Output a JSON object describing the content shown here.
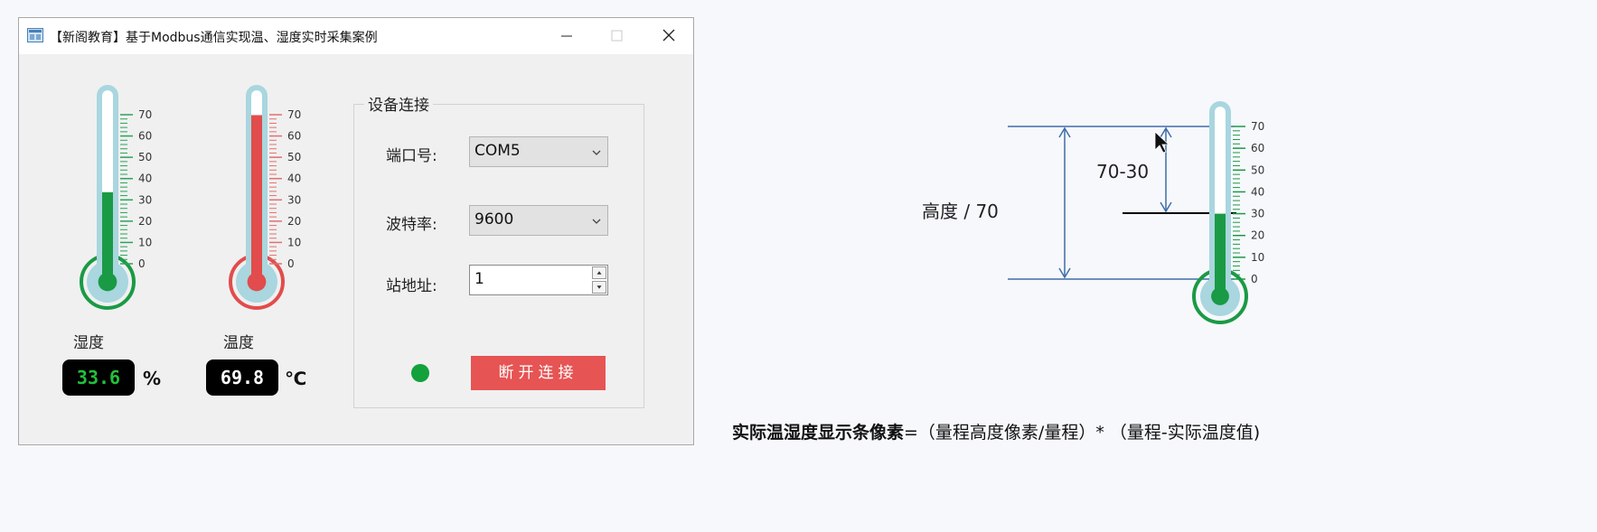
{
  "window": {
    "title": "【新阁教育】基于Modbus通信实现温、湿度实时采集案例",
    "icon": "app-icon",
    "controls": [
      "minimize-icon",
      "maximize-icon",
      "close-icon"
    ]
  },
  "humidity": {
    "label": "湿度",
    "value": "33.6",
    "unit": "%",
    "level": 33.6,
    "scale_max": 70,
    "ticks": [
      "70",
      "60",
      "50",
      "40",
      "30",
      "20",
      "10",
      "0"
    ],
    "fill_color": "#1a9a44",
    "scale_color": "#2aa35a",
    "value_color": "#22c03c"
  },
  "temperature": {
    "label": "温度",
    "value": "69.8",
    "unit": "℃",
    "level": 69.8,
    "scale_max": 70,
    "ticks": [
      "70",
      "60",
      "50",
      "40",
      "30",
      "20",
      "10",
      "0"
    ],
    "fill_color": "#e24c4c",
    "scale_color": "#e07070",
    "value_color": "#ffffff"
  },
  "connection": {
    "group_title": "设备连接",
    "port_label": "端口号:",
    "port_value": "COM5",
    "baud_label": "波特率:",
    "baud_value": "9600",
    "station_label": "站地址:",
    "station_value": "1",
    "status_color": "#12a13a",
    "button_label": "断开连接"
  },
  "diagram": {
    "height_label": "高度 / 70",
    "diff_label": "70-30",
    "level": 30,
    "scale_max": 70,
    "ticks": [
      "70",
      "60",
      "50",
      "40",
      "30",
      "20",
      "10",
      "0"
    ],
    "fill_color": "#1a9a44"
  },
  "formula": {
    "bold_part": "实际温湿度显示条像素",
    "rest": "=（量程高度像素/量程）*  （量程-实际温度值)"
  }
}
